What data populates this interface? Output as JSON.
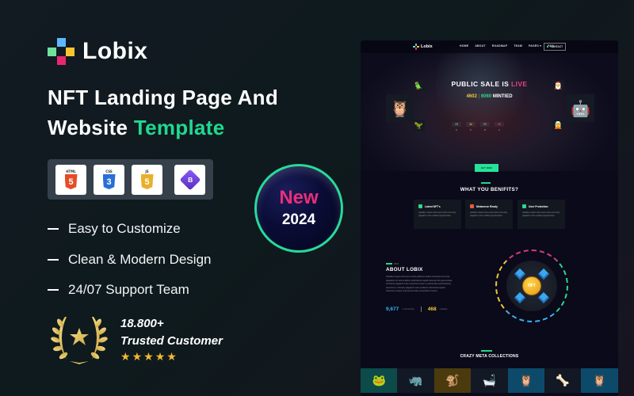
{
  "brand": {
    "name": "Lobix",
    "logo_colors": {
      "top": "#5fb8ff",
      "left": "#6fe09a",
      "right": "#f7c531",
      "bottom": "#e8286e"
    }
  },
  "headline": {
    "line1": "NFT Landing Page And",
    "line2_plain": "Website ",
    "line2_accent": "Template",
    "accent_color": "#20d88f"
  },
  "tech_stack": [
    {
      "name": "HTML",
      "icon": "html5-icon",
      "glyph": "5"
    },
    {
      "name": "CSS",
      "icon": "css3-icon",
      "glyph": "3"
    },
    {
      "name": "JS",
      "icon": "javascript-icon",
      "glyph": "5"
    },
    {
      "name": "Bootstrap",
      "icon": "bootstrap-icon",
      "glyph": "B"
    }
  ],
  "features": [
    "Easy to Customize",
    "Clean & Modern Design",
    "24/07 Support Team"
  ],
  "trust": {
    "count": "18.800+",
    "label": "Trusted Customer",
    "rating": 5,
    "star_glyph": "★"
  },
  "badge": {
    "label": "New",
    "year": "2024",
    "ring_color": "#28d99a",
    "label_color": "#ea2e77"
  },
  "preview": {
    "nav": {
      "logo": "Lobix",
      "menu": [
        "HOME",
        "ABOUT",
        "ROADMAP",
        "TEAM",
        "PAGES ▾",
        "FAQ"
      ],
      "contact": "CONTACT"
    },
    "hero": {
      "title": "PUBLIC SALE IS ",
      "title_accent": "LIVE",
      "minted_count": "4602",
      "separator": "|",
      "total_count": "6060",
      "minted_label": " MINTIED",
      "timer": [
        {
          "value": "25",
          "label": "D",
          "color": "#2fd58f"
        },
        {
          "value": "12",
          "label": "H",
          "color": "#f2c53a"
        },
        {
          "value": "50",
          "label": "M",
          "color": "#3ab0f0"
        },
        {
          "value": "40",
          "label": "S",
          "color": "#ec3e86"
        }
      ],
      "buy_button": "BUY NOW"
    },
    "benefits": {
      "title": "WHAT YOU BENIFITS?",
      "cards": [
        {
          "title": "Latest NFT's",
          "icon_color": "#2fd58f",
          "body": "Globally impact citrus and mortar immunity plagiarize web enabled opportunities."
        },
        {
          "title": "Metaverse Ready",
          "icon_color": "#e85a3a",
          "body": "Globally impact citrus and mortar immunity plagiarize web enabled opportunities."
        },
        {
          "title": "User Protection",
          "icon_color": "#2fd58f",
          "body": "Globally impact citrus and mortar immunity plagiarize web enabled opportunities."
        }
      ]
    },
    "about": {
      "title": "ABOUT LOBIX",
      "body": "Globally impact citrus and mortar platforms before functional immunity plagiarize for web-enabled multicultural capital whereas full opportunities. Intrinsicly plagiarize fully researched value to partnership authoritatively bounteous. Intrinsicly plagiarize web-enabled multicultural capital whereas is bogus empowered value propositions impact.",
      "stats": [
        {
          "value": "9,677",
          "label": "TOTAL MINTED",
          "color": "#2fb8f0"
        },
        {
          "value": "468",
          "label": "OWNERS",
          "color": "#f2c53a"
        }
      ],
      "nft_label": "NFT"
    },
    "collections": {
      "title": "CRAZY META COLLECTIONS",
      "items": [
        {
          "bg": "#0d4a4a",
          "glyph": "🐸"
        },
        {
          "bg": "#121824",
          "glyph": "🦏"
        },
        {
          "bg": "#4a3a0e",
          "glyph": "🐒"
        },
        {
          "bg": "#121824",
          "glyph": "🛁"
        },
        {
          "bg": "#0d4a6a",
          "glyph": "🦉"
        },
        {
          "bg": "#121824",
          "glyph": "🦴"
        },
        {
          "bg": "#0d4a6a",
          "glyph": "🦉"
        }
      ]
    },
    "characters": [
      {
        "glyph": "🦉"
      },
      {
        "glyph": "🦜"
      },
      {
        "glyph": "🦖"
      },
      {
        "glyph": "🎅"
      },
      {
        "glyph": "🤖"
      },
      {
        "glyph": "🧝"
      }
    ]
  }
}
